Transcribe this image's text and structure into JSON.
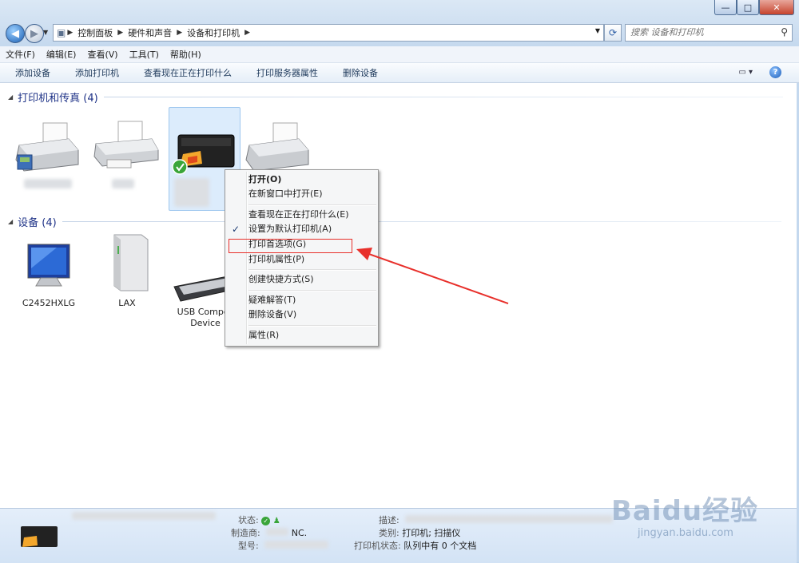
{
  "window": {
    "minimize": "—",
    "maximize": "□",
    "close": "✕"
  },
  "address": {
    "crumbs": [
      "控制面板",
      "硬件和声音",
      "设备和打印机"
    ],
    "search_placeholder": "搜索 设备和打印机"
  },
  "menu": [
    "文件(F)",
    "编辑(E)",
    "查看(V)",
    "工具(T)",
    "帮助(H)"
  ],
  "commands": [
    "添加设备",
    "添加打印机",
    "查看现在正在打印什么",
    "打印服务器属性",
    "删除设备"
  ],
  "groups": {
    "printers": {
      "title": "打印机和传真 (4)"
    },
    "devices": {
      "title": "设备 (4)"
    }
  },
  "selected_printer_label": "Canon ...的 ...00\n...ter",
  "devices": [
    {
      "label": "C2452HXLG",
      "icon": "monitor-icon"
    },
    {
      "label": "LAX",
      "icon": "external-drive-icon"
    },
    {
      "label": "USB Compos\nDevice",
      "icon": "keyboard-icon"
    }
  ],
  "context_menu": {
    "open": "打开(O)",
    "open_new": "在新窗口中打开(E)",
    "see_printing": "查看现在正在打印什么(E)",
    "set_default": "设置为默认打印机(A)",
    "preferences": "打印首选项(G)",
    "properties_printer": "打印机属性(P)",
    "shortcut": "创建快捷方式(S)",
    "troubleshoot": "疑难解答(T)",
    "remove": "删除设备(V)",
    "properties": "属性(R)"
  },
  "status": {
    "state_label": "状态:",
    "maker_label": "制造商:",
    "maker_value": "NC.",
    "model_label": "型号:",
    "desc_label": "描述:",
    "category_label": "类别:",
    "category_value": "打印机; 扫描仪",
    "printer_state_label": "打印机状态:",
    "printer_state_value": "队列中有 0 个文档"
  },
  "watermark": {
    "brand": "Baidu经验",
    "url": "jingyan.baidu.com"
  },
  "colors": {
    "accent": "#1e3287",
    "annotation": "#e8302b"
  }
}
